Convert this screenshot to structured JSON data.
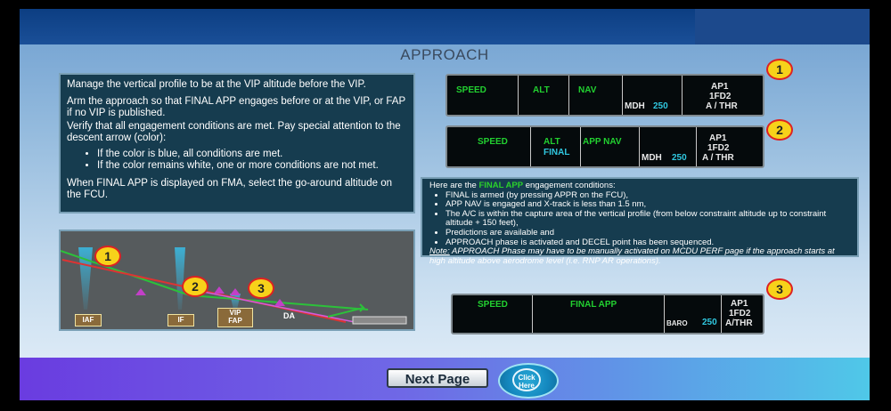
{
  "title": "APPROACH",
  "instructions": {
    "p1": "Manage the vertical profile to be at the VIP altitude before the VIP.",
    "p2": "Arm the approach so that FINAL APP engages before or at the VIP, or FAP if no VIP is published.",
    "p3": "Verify that all engagement conditions are met. Pay special attention to the descent arrow (color):",
    "bullets": [
      "If the color is blue, all conditions are met.",
      "If the color remains white, one or more conditions are not met."
    ],
    "p4": "When FINAL APP is displayed on FMA, select the go-around altitude on the FCU."
  },
  "fma1": {
    "speed": "SPEED",
    "alt": "ALT",
    "nav": "NAV",
    "mdh": "MDH",
    "mdh_val": "250",
    "ap": "AP1",
    "fd": "1FD2",
    "athr": "A / THR",
    "badge": "1"
  },
  "fma2": {
    "speed": "SPEED",
    "alt": "ALT",
    "final": "FINAL",
    "appnav": "APP NAV",
    "mdh": "MDH",
    "mdh_val": "250",
    "ap": "AP1",
    "fd": "1FD2",
    "athr": "A / THR",
    "badge": "2"
  },
  "fma3": {
    "speed": "SPEED",
    "finalapp": "FINAL APP",
    "baro": "BARO",
    "baro_val": "250",
    "ap": "AP1",
    "fd": "1FD2",
    "athr": "A/THR",
    "badge": "3"
  },
  "conditions": {
    "intro_pre": "Here are the ",
    "intro_hl": "FINAL APP",
    "intro_post": " engagement conditions:",
    "items": [
      "FINAL is armed (by pressing APPR on the FCU),",
      "APP NAV is engaged and X-track is less than 1.5 nm,",
      "The A/C is within the capture area of the vertical profile (from below constraint altitude up to constraint altitude + 150 feet),",
      "Predictions are available and",
      "APPROACH phase is activated and DECEL point has been sequenced."
    ],
    "note_label": "Note:",
    "note": " APPROACH Phase may have to be manually activated on MCDU PERF page if the approach starts at high altitude above aerodrome level (i.e. RNP AR operations)."
  },
  "diagram": {
    "iaf": "IAF",
    "if": "IF",
    "vip": "VIP",
    "fap": "FAP",
    "da": "DA",
    "badges": [
      "1",
      "2",
      "3"
    ]
  },
  "nav": {
    "next_page": "Next Page",
    "click_here_1": "Click",
    "click_here_2": "Here"
  }
}
